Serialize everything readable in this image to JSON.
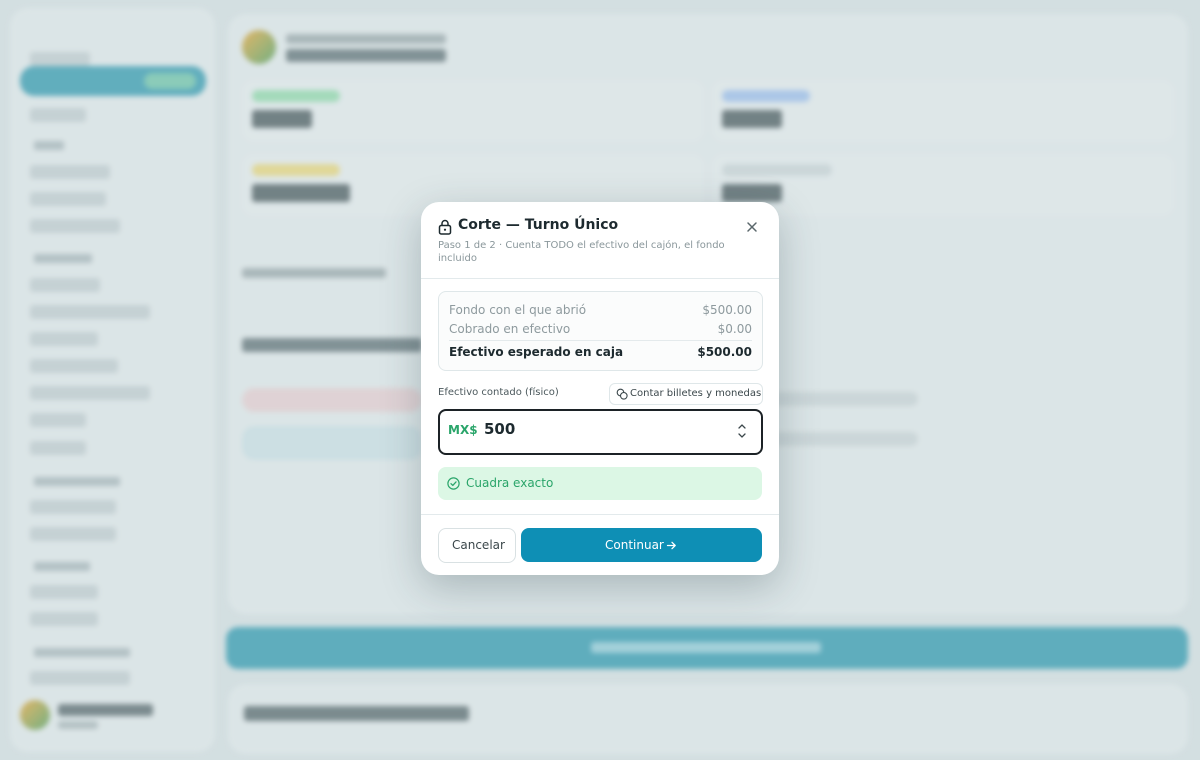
{
  "modal": {
    "title": "Corte — Turno Único",
    "subtitle": "Paso 1 de 2 · Cuenta TODO el efectivo del cajón, el fondo incluido",
    "summary": {
      "opening_label": "Fondo con el que abrió",
      "opening_value": "$500.00",
      "cash_label": "Cobrado en efectivo",
      "cash_value": "$0.00",
      "expected_label": "Efectivo esperado en caja",
      "expected_value": "$500.00"
    },
    "counted_label": "Efectivo contado (físico)",
    "count_button_label": "Contar billetes y monedas",
    "currency": "MX$",
    "amount_value": "500",
    "status_text": "Cuadra exacto",
    "cancel_label": "Cancelar",
    "continue_label": "Continuar"
  },
  "colors": {
    "accent": "#0e8fb5",
    "success": "#2aa56a",
    "success_bg": "#dcf7e5"
  },
  "icons": [
    "lock-icon",
    "close-icon",
    "coins-icon",
    "stepper-icon",
    "check-circle-icon",
    "arrow-right-icon"
  ]
}
